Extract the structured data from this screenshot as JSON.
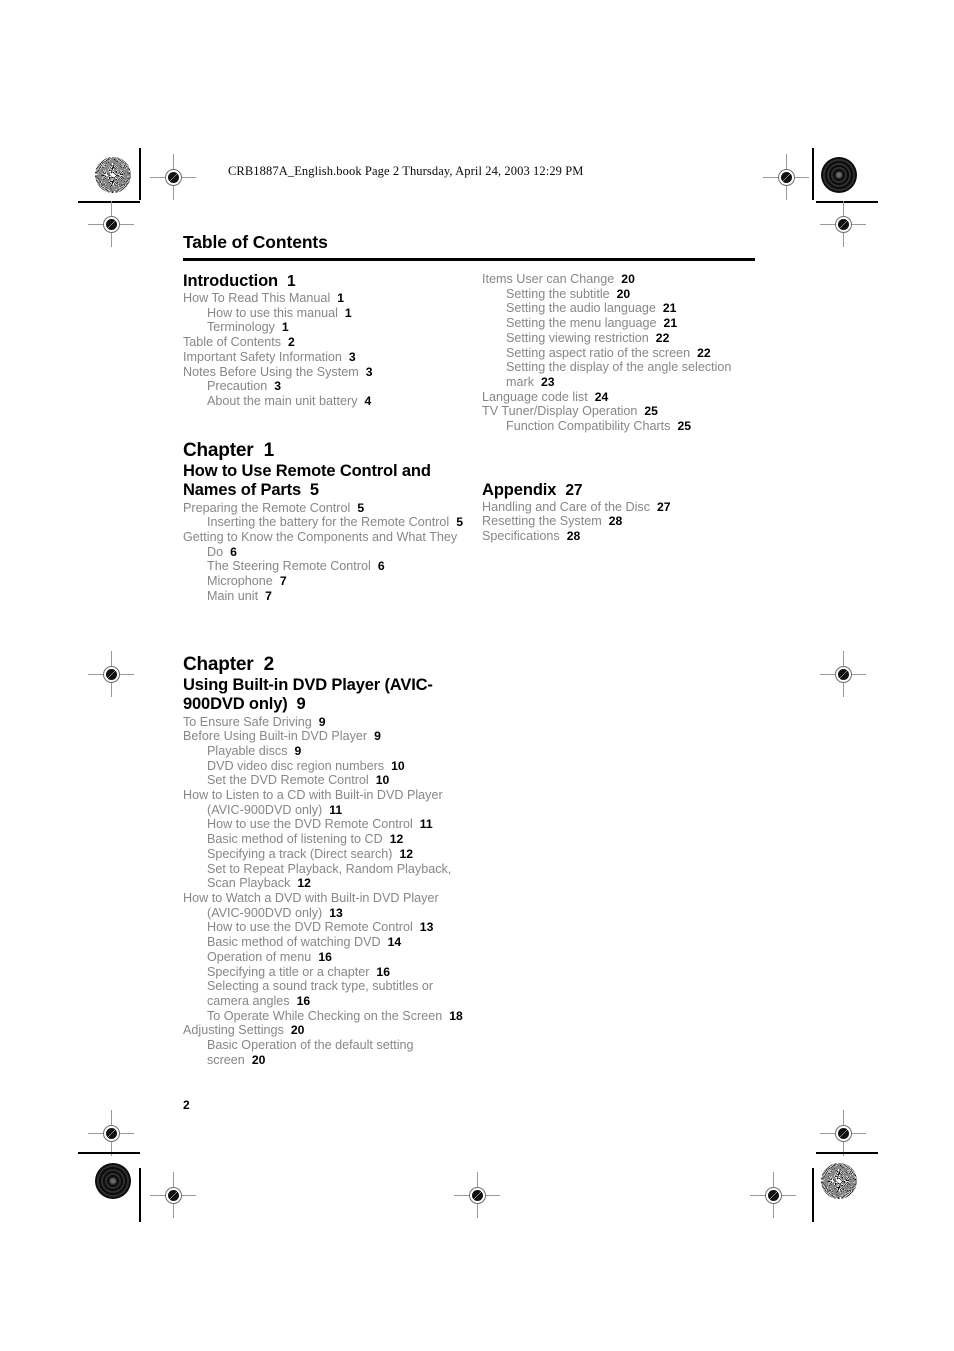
{
  "header": {
    "slug": "CRB1887A_English.book  Page 2  Thursday, April 24, 2003  12:29 PM"
  },
  "page": {
    "title": "Table of Contents",
    "folio": "2"
  },
  "left_column": [
    {
      "kind": "section",
      "label": "Introduction",
      "page": "1"
    },
    {
      "kind": "entry",
      "level": 1,
      "label": "How To Read This Manual",
      "page": "1"
    },
    {
      "kind": "entry",
      "level": 2,
      "label": "How to use this manual",
      "page": "1"
    },
    {
      "kind": "entry",
      "level": 2,
      "label": "Terminology",
      "page": "1"
    },
    {
      "kind": "entry",
      "level": 1,
      "label": "Table of Contents",
      "page": "2"
    },
    {
      "kind": "entry",
      "level": 1,
      "label": "Important Safety Information",
      "page": "3"
    },
    {
      "kind": "entry",
      "level": 1,
      "label": "Notes Before Using the System",
      "page": "3"
    },
    {
      "kind": "entry",
      "level": 2,
      "label": "Precaution",
      "page": "3"
    },
    {
      "kind": "entry",
      "level": 2,
      "label": "About the main unit battery",
      "page": "4"
    },
    {
      "kind": "gap",
      "size": "l"
    },
    {
      "kind": "chapter",
      "label": "Chapter",
      "number": "1"
    },
    {
      "kind": "chapter_title",
      "label": "How to Use Remote Control and Names of Parts",
      "page": "5"
    },
    {
      "kind": "entry",
      "level": 1,
      "label": "Preparing the Remote Control",
      "page": "5"
    },
    {
      "kind": "entry",
      "level": 2,
      "label": "Inserting the battery for the Remote Control",
      "page": "5"
    },
    {
      "kind": "entry",
      "level": 1,
      "label": "Getting to Know the Components and What They Do",
      "page": "6"
    },
    {
      "kind": "entry",
      "level": 2,
      "label": "The Steering Remote Control",
      "page": "6"
    },
    {
      "kind": "entry",
      "level": 2,
      "label": "Microphone",
      "page": "7"
    },
    {
      "kind": "entry",
      "level": 2,
      "label": "Main unit",
      "page": "7"
    },
    {
      "kind": "gap",
      "size": "xl"
    },
    {
      "kind": "chapter",
      "label": "Chapter",
      "number": "2"
    },
    {
      "kind": "chapter_title",
      "label": "Using Built-in DVD Player (AVIC-900DVD only)",
      "page": "9"
    },
    {
      "kind": "entry",
      "level": 1,
      "label": "To Ensure Safe Driving",
      "page": "9"
    },
    {
      "kind": "entry",
      "level": 1,
      "label": "Before Using Built-in DVD Player",
      "page": "9"
    },
    {
      "kind": "entry",
      "level": 2,
      "label": "Playable discs",
      "page": "9"
    },
    {
      "kind": "entry",
      "level": 2,
      "label": "DVD video disc region numbers",
      "page": "10"
    },
    {
      "kind": "entry",
      "level": 2,
      "label": "Set the DVD Remote Control",
      "page": "10"
    },
    {
      "kind": "entry",
      "level": 1,
      "label": "How to Listen to a CD with Built-in DVD Player (AVIC-900DVD only)",
      "page": "11"
    },
    {
      "kind": "entry",
      "level": 2,
      "label": "How to use the DVD Remote Control",
      "page": "11"
    },
    {
      "kind": "entry",
      "level": 2,
      "label": "Basic method of listening to CD",
      "page": "12"
    },
    {
      "kind": "entry",
      "level": 2,
      "label": "Specifying a track (Direct search)",
      "page": "12"
    },
    {
      "kind": "entry",
      "level": 2,
      "label": "Set to Repeat Playback, Random Playback, Scan Playback",
      "page": "12"
    },
    {
      "kind": "entry",
      "level": 1,
      "label": "How to Watch a DVD with Built-in DVD Player (AVIC-900DVD only)",
      "page": "13"
    },
    {
      "kind": "entry",
      "level": 2,
      "label": "How to use the DVD Remote Control",
      "page": "13"
    },
    {
      "kind": "entry",
      "level": 2,
      "label": "Basic method of watching DVD",
      "page": "14"
    },
    {
      "kind": "entry",
      "level": 2,
      "label": "Operation of menu",
      "page": "16"
    },
    {
      "kind": "entry",
      "level": 2,
      "label": "Specifying a title or a chapter",
      "page": "16"
    },
    {
      "kind": "entry",
      "level": 2,
      "label": "Selecting a sound track type, subtitles or camera angles",
      "page": "16"
    },
    {
      "kind": "entry",
      "level": 2,
      "label": "To Operate While Checking on the Screen",
      "page": "18"
    },
    {
      "kind": "entry",
      "level": 1,
      "label": "Adjusting Settings",
      "page": "20"
    },
    {
      "kind": "entry",
      "level": 2,
      "label": "Basic Operation of the default setting screen",
      "page": "20"
    }
  ],
  "right_column": [
    {
      "kind": "entry",
      "level": 1,
      "label": "Items User can Change",
      "page": "20"
    },
    {
      "kind": "entry",
      "level": 2,
      "label": "Setting the subtitle",
      "page": "20"
    },
    {
      "kind": "entry",
      "level": 2,
      "label": "Setting the audio language",
      "page": "21"
    },
    {
      "kind": "entry",
      "level": 2,
      "label": "Setting the menu language",
      "page": "21"
    },
    {
      "kind": "entry",
      "level": 2,
      "label": "Setting viewing restriction",
      "page": "22"
    },
    {
      "kind": "entry",
      "level": 2,
      "label": "Setting aspect ratio of the screen",
      "page": "22"
    },
    {
      "kind": "entry",
      "level": 2,
      "label": "Setting the display of the angle selection mark",
      "page": "23"
    },
    {
      "kind": "entry",
      "level": 1,
      "label": "Language code list",
      "page": "24"
    },
    {
      "kind": "entry",
      "level": 1,
      "label": "TV Tuner/Display Operation",
      "page": "25"
    },
    {
      "kind": "entry",
      "level": 2,
      "label": "Function Compatibility Charts",
      "page": "25"
    },
    {
      "kind": "gap",
      "size": "ap"
    },
    {
      "kind": "section",
      "label": "Appendix",
      "page": "27"
    },
    {
      "kind": "entry",
      "level": 1,
      "label": "Handling and Care of the Disc",
      "page": "27"
    },
    {
      "kind": "entry",
      "level": 1,
      "label": "Resetting the System",
      "page": "28"
    },
    {
      "kind": "entry",
      "level": 1,
      "label": "Specifications",
      "page": "28"
    }
  ]
}
